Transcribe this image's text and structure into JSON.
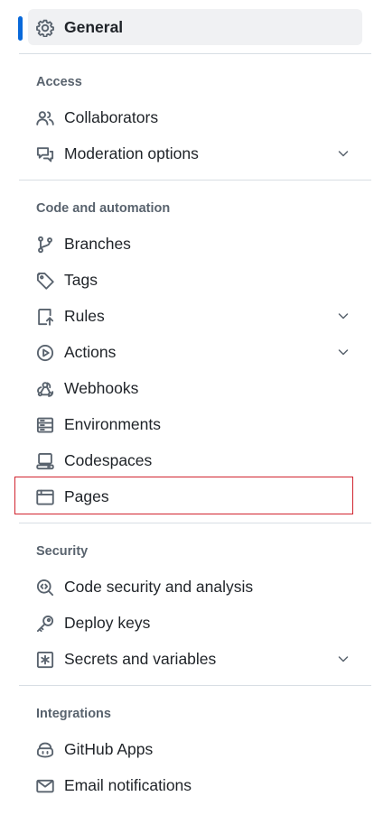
{
  "general": {
    "label": "General",
    "icon": "gear-icon"
  },
  "sections": {
    "access": {
      "heading": "Access",
      "items": [
        {
          "label": "Collaborators",
          "icon": "people-icon",
          "expandable": false
        },
        {
          "label": "Moderation options",
          "icon": "comment-discussion-icon",
          "expandable": true
        }
      ]
    },
    "code": {
      "heading": "Code and automation",
      "items": [
        {
          "label": "Branches",
          "icon": "git-branch-icon",
          "expandable": false
        },
        {
          "label": "Tags",
          "icon": "tag-icon",
          "expandable": false
        },
        {
          "label": "Rules",
          "icon": "repo-push-icon",
          "expandable": true
        },
        {
          "label": "Actions",
          "icon": "play-icon",
          "expandable": true
        },
        {
          "label": "Webhooks",
          "icon": "webhook-icon",
          "expandable": false
        },
        {
          "label": "Environments",
          "icon": "server-icon",
          "expandable": false
        },
        {
          "label": "Codespaces",
          "icon": "codespaces-icon",
          "expandable": false
        },
        {
          "label": "Pages",
          "icon": "browser-icon",
          "expandable": false,
          "highlighted": true
        }
      ]
    },
    "security": {
      "heading": "Security",
      "items": [
        {
          "label": "Code security and analysis",
          "icon": "codescan-icon",
          "expandable": false
        },
        {
          "label": "Deploy keys",
          "icon": "key-icon",
          "expandable": false
        },
        {
          "label": "Secrets and variables",
          "icon": "key-asterisk-icon",
          "expandable": true
        }
      ]
    },
    "integrations": {
      "heading": "Integrations",
      "items": [
        {
          "label": "GitHub Apps",
          "icon": "copilot-icon",
          "expandable": false
        },
        {
          "label": "Email notifications",
          "icon": "mail-icon",
          "expandable": false
        }
      ]
    }
  },
  "colors": {
    "accent": "#0969da",
    "highlight": "#d1242f",
    "selected_bg": "#f0f1f3",
    "muted_text": "#59636e"
  }
}
